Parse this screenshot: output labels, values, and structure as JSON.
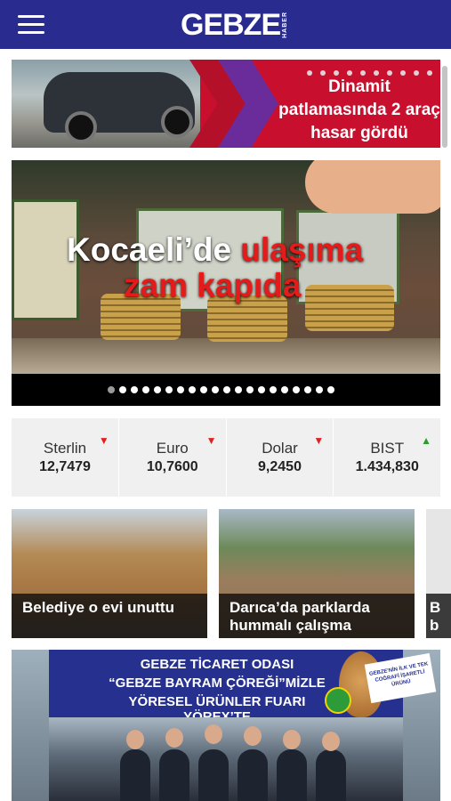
{
  "header": {
    "logo_main": "GEBZE",
    "logo_sub": "HABER",
    "brand_color": "#2a2b8f"
  },
  "banner_top": {
    "headline": "Dinamit patlamasında 2 araç hasar gördü",
    "accent": "#c8102e"
  },
  "slider": {
    "headline_white": "Kocaeli’de ",
    "headline_red_1": "ulaşıma",
    "headline_red_2": "zam kapıda",
    "slide_count": 20,
    "active_index": 0
  },
  "market": [
    {
      "name": "Sterlin",
      "value": "12,7479",
      "trend": "down",
      "arrow": "▼"
    },
    {
      "name": "Euro",
      "value": "10,7600",
      "trend": "down",
      "arrow": "▼"
    },
    {
      "name": "Dolar",
      "value": "9,2450",
      "trend": "down",
      "arrow": "▼"
    },
    {
      "name": "BIST",
      "value": "1.434,830",
      "trend": "up",
      "arrow": "▲"
    }
  ],
  "cards": [
    {
      "title": "Belediye o evi unuttu"
    },
    {
      "title": "Darıca’da parklarda hummalı çalışma"
    },
    {
      "title": "B b"
    }
  ],
  "ad": {
    "line1": "GEBZE TİCARET ODASI",
    "line2": "“GEBZE BAYRAM ÇÖREĞİ”MİZLE",
    "line3": "YÖRESEL ÜRÜNLER FUARI YÖREX’TE",
    "badge": "GEBZE'NİN İLK VE TEK COĞRAFİ İŞARETLİ ÜRÜNÜ"
  }
}
